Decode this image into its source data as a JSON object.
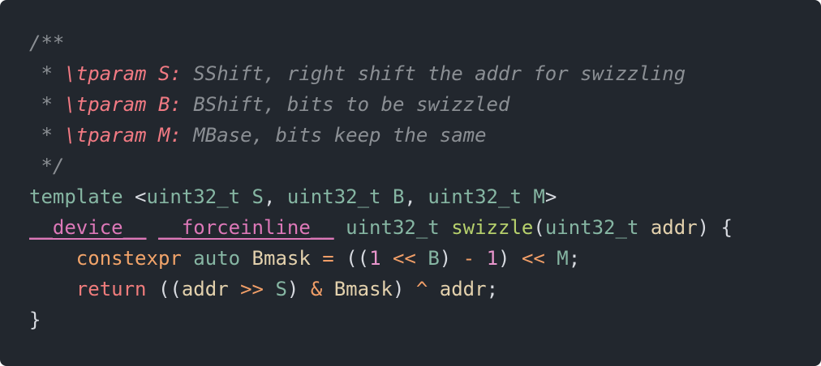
{
  "code": {
    "lines": [
      [
        {
          "text": "/**",
          "kind": "comment"
        }
      ],
      [
        {
          "text": " * ",
          "kind": "comment"
        },
        {
          "text": "\\tparam S:",
          "kind": "tag"
        },
        {
          "text": " SShift, right shift the addr for swizzling",
          "kind": "comment"
        }
      ],
      [
        {
          "text": " * ",
          "kind": "comment"
        },
        {
          "text": "\\tparam B:",
          "kind": "tag"
        },
        {
          "text": " BShift, bits to be swizzled",
          "kind": "comment"
        }
      ],
      [
        {
          "text": " * ",
          "kind": "comment"
        },
        {
          "text": "\\tparam M:",
          "kind": "tag"
        },
        {
          "text": " MBase, bits keep the same",
          "kind": "comment"
        }
      ],
      [
        {
          "text": " */",
          "kind": "comment"
        }
      ],
      [
        {
          "text": "template",
          "kind": "type"
        },
        {
          "text": " ",
          "kind": "plain"
        },
        {
          "text": "<",
          "kind": "punct"
        },
        {
          "text": "uint32_t",
          "kind": "type"
        },
        {
          "text": " ",
          "kind": "plain"
        },
        {
          "text": "S",
          "kind": "type"
        },
        {
          "text": ", ",
          "kind": "punct"
        },
        {
          "text": "uint32_t",
          "kind": "type"
        },
        {
          "text": " ",
          "kind": "plain"
        },
        {
          "text": "B",
          "kind": "type"
        },
        {
          "text": ", ",
          "kind": "punct"
        },
        {
          "text": "uint32_t",
          "kind": "type"
        },
        {
          "text": " ",
          "kind": "plain"
        },
        {
          "text": "M",
          "kind": "type"
        },
        {
          "text": ">",
          "kind": "punct"
        }
      ],
      [
        {
          "text": "__device__",
          "kind": "macro"
        },
        {
          "text": " ",
          "kind": "plain"
        },
        {
          "text": "__forceinline__",
          "kind": "macro"
        },
        {
          "text": " ",
          "kind": "plain"
        },
        {
          "text": "uint32_t",
          "kind": "type"
        },
        {
          "text": " ",
          "kind": "plain"
        },
        {
          "text": "swizzle",
          "kind": "func"
        },
        {
          "text": "(",
          "kind": "punct"
        },
        {
          "text": "uint32_t",
          "kind": "type"
        },
        {
          "text": " ",
          "kind": "plain"
        },
        {
          "text": "addr",
          "kind": "ident"
        },
        {
          "text": ") {",
          "kind": "punct"
        }
      ],
      [
        {
          "text": "    ",
          "kind": "plain"
        },
        {
          "text": "constexpr",
          "kind": "keyword2"
        },
        {
          "text": " ",
          "kind": "plain"
        },
        {
          "text": "auto",
          "kind": "type"
        },
        {
          "text": " ",
          "kind": "plain"
        },
        {
          "text": "Bmask",
          "kind": "ident"
        },
        {
          "text": " = ",
          "kind": "operator"
        },
        {
          "text": "((",
          "kind": "punct"
        },
        {
          "text": "1",
          "kind": "number"
        },
        {
          "text": " << ",
          "kind": "operator"
        },
        {
          "text": "B",
          "kind": "type"
        },
        {
          "text": ") ",
          "kind": "punct"
        },
        {
          "text": "- ",
          "kind": "operator"
        },
        {
          "text": "1",
          "kind": "number"
        },
        {
          "text": ") ",
          "kind": "punct"
        },
        {
          "text": "<< ",
          "kind": "operator"
        },
        {
          "text": "M",
          "kind": "type"
        },
        {
          "text": ";",
          "kind": "punct"
        }
      ],
      [
        {
          "text": "    ",
          "kind": "plain"
        },
        {
          "text": "return",
          "kind": "keyword"
        },
        {
          "text": " ",
          "kind": "plain"
        },
        {
          "text": "((",
          "kind": "punct"
        },
        {
          "text": "addr",
          "kind": "ident"
        },
        {
          "text": " >> ",
          "kind": "operator"
        },
        {
          "text": "S",
          "kind": "type"
        },
        {
          "text": ") ",
          "kind": "punct"
        },
        {
          "text": "& ",
          "kind": "operator"
        },
        {
          "text": "Bmask",
          "kind": "ident"
        },
        {
          "text": ") ",
          "kind": "punct"
        },
        {
          "text": "^ ",
          "kind": "operator"
        },
        {
          "text": "addr",
          "kind": "ident"
        },
        {
          "text": ";",
          "kind": "punct"
        }
      ],
      [
        {
          "text": "}",
          "kind": "punct"
        }
      ]
    ]
  },
  "colors": {
    "background": "#22272e",
    "comment": "#8b8f94",
    "tag": "#f17a83",
    "type": "#86b6a3",
    "keyword": "#f07c7c",
    "keyword2": "#f2a46a",
    "ident": "#e3d1ad",
    "func": "#b6d06c",
    "macro": "#dd78b8",
    "number": "#e895cc",
    "operator": "#f29f68",
    "plain": "#d7dae0"
  }
}
